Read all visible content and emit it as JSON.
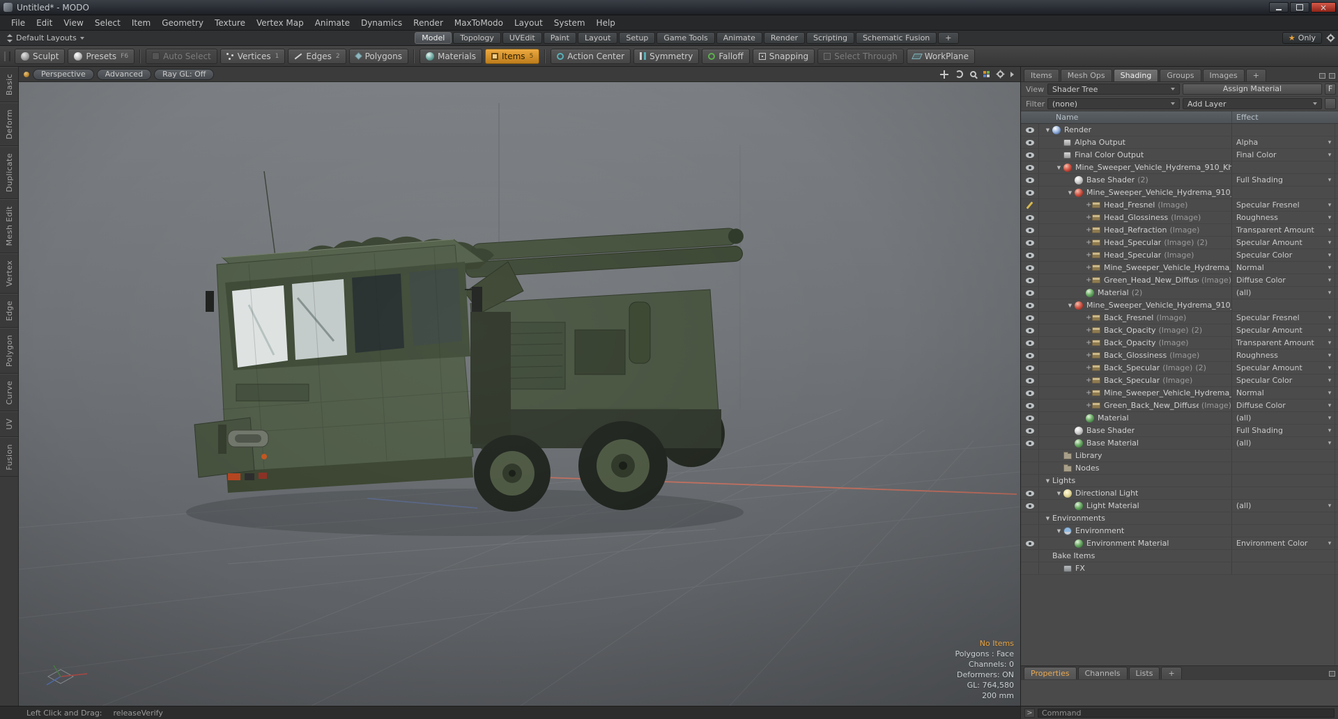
{
  "window": {
    "title": "Untitled* - MODO"
  },
  "menu": [
    "File",
    "Edit",
    "View",
    "Select",
    "Item",
    "Geometry",
    "Texture",
    "Vertex Map",
    "Animate",
    "Dynamics",
    "Render",
    "MaxToModo",
    "Layout",
    "System",
    "Help"
  ],
  "layout_bar": {
    "default_layouts": "Default Layouts",
    "tabs": [
      {
        "label": "Model",
        "active": true
      },
      {
        "label": "Topology"
      },
      {
        "label": "UVEdit"
      },
      {
        "label": "Paint"
      },
      {
        "label": "Layout"
      },
      {
        "label": "Setup"
      },
      {
        "label": "Game Tools"
      },
      {
        "label": "Animate"
      },
      {
        "label": "Render"
      },
      {
        "label": "Scripting"
      },
      {
        "label": "Schematic Fusion"
      },
      {
        "label": "+"
      }
    ],
    "only_label": "Only"
  },
  "toolbar": {
    "buttons": [
      {
        "label": "Sculpt",
        "icon": "sculpt-icon"
      },
      {
        "label": "Presets",
        "hint": "F6",
        "icon": "presets-icon"
      },
      {
        "sep": true
      },
      {
        "label": "Auto Select",
        "icon": "auto-select-icon",
        "disabled": true
      },
      {
        "label": "Vertices",
        "hint": "1",
        "icon": "vertices-icon"
      },
      {
        "label": "Edges",
        "hint": "2",
        "icon": "edges-icon"
      },
      {
        "label": "Polygons",
        "icon": "polygons-icon"
      },
      {
        "sep": true
      },
      {
        "label": "Materials",
        "icon": "materials-icon"
      },
      {
        "label": "Items",
        "hint": "5",
        "icon": "items-icon",
        "active": true
      },
      {
        "sep": true
      },
      {
        "label": "Action Center",
        "icon": "action-center-icon"
      },
      {
        "label": "Symmetry",
        "icon": "symmetry-icon"
      },
      {
        "label": "Falloff",
        "icon": "falloff-icon"
      },
      {
        "label": "Snapping",
        "icon": "snapping-icon"
      },
      {
        "label": "Select Through",
        "icon": "select-through-icon",
        "disabled": true
      },
      {
        "label": "WorkPlane",
        "icon": "workplane-icon"
      }
    ]
  },
  "left_tabs": [
    "Basic",
    "Deform",
    "Duplicate",
    "Mesh Edit",
    "Vertex",
    "Edge",
    "Polygon",
    "Curve",
    "UV",
    "Fusion"
  ],
  "viewport": {
    "tabs": [
      "Perspective",
      "Advanced",
      "Ray GL: Off"
    ],
    "stats": {
      "highlight": "No Items",
      "lines": [
        "Polygons : Face",
        "Channels: 0",
        "Deformers: ON",
        "GL: 764,580",
        "200 mm"
      ]
    }
  },
  "right_panel": {
    "tabs": [
      {
        "label": "Items"
      },
      {
        "label": "Mesh Ops"
      },
      {
        "label": "Shading",
        "active": true
      },
      {
        "label": "Groups"
      },
      {
        "label": "Images"
      },
      {
        "label": "+"
      }
    ],
    "view_label": "View",
    "view_value": "Shader Tree",
    "assign_material": "Assign Material",
    "f_button": "F",
    "filter_label": "Filter",
    "filter_value": "(none)",
    "add_layer": "Add Layer",
    "columns": {
      "name": "Name",
      "effect": "Effect"
    },
    "bottom_tabs": [
      {
        "label": "Properties",
        "active": true
      },
      {
        "label": "Channels"
      },
      {
        "label": "Lists"
      },
      {
        "label": "+"
      }
    ],
    "command_prompt": ">",
    "command_placeholder": "Command"
  },
  "shader_tree": {
    "rows": [
      {
        "d": 0,
        "a": 1,
        "g": "eye",
        "i": "render-icon",
        "t": "Render"
      },
      {
        "d": 1,
        "g": "eye",
        "i": "output-icon",
        "t": "Alpha Output",
        "e": "Alpha"
      },
      {
        "d": 1,
        "g": "eye",
        "i": "output-icon",
        "t": "Final Color Output",
        "e": "Final Color"
      },
      {
        "d": 1,
        "a": 1,
        "g": "eye",
        "i": "material-group-icon",
        "t": "Mine_Sweeper_Vehicle_Hydrema_910_Kh..."
      },
      {
        "d": 2,
        "g": "eye",
        "i": "shader-icon",
        "t": "Base Shader",
        "c": "(2)",
        "e": "Full Shading"
      },
      {
        "d": 2,
        "a": 1,
        "g": "eye",
        "i": "material-group-icon",
        "t": "Mine_Sweeper_Vehicle_Hydrema_910_..."
      },
      {
        "d": 3,
        "p": 1,
        "g": "pen",
        "i": "image-icon",
        "t": "Head_Fresnel",
        "s": "(Image)",
        "e": "Specular Fresnel"
      },
      {
        "d": 3,
        "p": 1,
        "g": "eye",
        "i": "image-icon",
        "t": "Head_Glossiness",
        "s": "(Image)",
        "e": "Roughness"
      },
      {
        "d": 3,
        "p": 1,
        "g": "eye",
        "i": "image-icon",
        "t": "Head_Refraction",
        "s": "(Image)",
        "e": "Transparent Amount"
      },
      {
        "d": 3,
        "p": 1,
        "g": "eye",
        "i": "image-icon",
        "t": "Head_Specular",
        "s": "(Image)",
        "c": "(2)",
        "e": "Specular Amount"
      },
      {
        "d": 3,
        "p": 1,
        "g": "eye",
        "i": "image-icon",
        "t": "Head_Specular",
        "s": "(Image)",
        "e": "Specular Color"
      },
      {
        "d": 3,
        "p": 1,
        "g": "eye",
        "i": "image-icon",
        "t": "Mine_Sweeper_Vehicle_Hydrema_91...",
        "e": "Normal"
      },
      {
        "d": 3,
        "p": 1,
        "g": "eye",
        "i": "image-icon",
        "t": "Green_Head_New_Diffuse",
        "s": "(Image)",
        "e": "Diffuse Color"
      },
      {
        "d": 3,
        "g": "eye",
        "i": "material-icon",
        "t": "Material",
        "c": "(2)",
        "e": "(all)"
      },
      {
        "d": 2,
        "a": 1,
        "g": "eye",
        "i": "material-group-icon",
        "t": "Mine_Sweeper_Vehicle_Hydrema_910_..."
      },
      {
        "d": 3,
        "p": 1,
        "g": "eye",
        "i": "image-icon",
        "t": "Back_Fresnel",
        "s": "(Image)",
        "e": "Specular Fresnel"
      },
      {
        "d": 3,
        "p": 1,
        "g": "eye",
        "i": "image-icon",
        "t": "Back_Opacity",
        "s": "(Image)",
        "c": "(2)",
        "e": "Specular Amount"
      },
      {
        "d": 3,
        "p": 1,
        "g": "eye",
        "i": "image-icon",
        "t": "Back_Opacity",
        "s": "(Image)",
        "e": "Transparent Amount"
      },
      {
        "d": 3,
        "p": 1,
        "g": "eye",
        "i": "image-icon",
        "t": "Back_Glossiness",
        "s": "(Image)",
        "e": "Roughness"
      },
      {
        "d": 3,
        "p": 1,
        "g": "eye",
        "i": "image-icon",
        "t": "Back_Specular",
        "s": "(Image)",
        "c": "(2)",
        "e": "Specular Amount"
      },
      {
        "d": 3,
        "p": 1,
        "g": "eye",
        "i": "image-icon",
        "t": "Back_Specular",
        "s": "(Image)",
        "e": "Specular Color"
      },
      {
        "d": 3,
        "p": 1,
        "g": "eye",
        "i": "image-icon",
        "t": "Mine_Sweeper_Vehicle_Hydrema_91...",
        "e": "Normal"
      },
      {
        "d": 3,
        "p": 1,
        "g": "eye",
        "i": "image-icon",
        "t": "Green_Back_New_Diffuse",
        "s": "(Image)",
        "e": "Diffuse Color"
      },
      {
        "d": 3,
        "g": "eye",
        "i": "material-icon",
        "t": "Material",
        "e": "(all)"
      },
      {
        "d": 2,
        "g": "eye",
        "i": "shader-icon",
        "t": "Base Shader",
        "e": "Full Shading"
      },
      {
        "d": 2,
        "g": "eye",
        "i": "material-icon",
        "t": "Base Material",
        "e": "(all)"
      },
      {
        "d": 1,
        "i": "folder-icon",
        "t": "Library"
      },
      {
        "d": 1,
        "i": "folder-icon",
        "t": "Nodes"
      },
      {
        "d": 0,
        "a": 1,
        "t": "Lights"
      },
      {
        "d": 1,
        "a": 1,
        "g": "eye",
        "i": "light-icon",
        "t": "Directional Light"
      },
      {
        "d": 2,
        "g": "eye",
        "i": "material-icon",
        "t": "Light Material",
        "e": "(all)"
      },
      {
        "d": 0,
        "a": 1,
        "t": "Environments"
      },
      {
        "d": 1,
        "a": 1,
        "i": "environment-icon",
        "t": "Environment"
      },
      {
        "d": 2,
        "g": "eye",
        "i": "material-icon",
        "t": "Environment Material",
        "e": "Environment Color"
      },
      {
        "d": 0,
        "t": "Bake Items"
      },
      {
        "d": 1,
        "i": "fx-icon",
        "t": "FX"
      }
    ]
  },
  "status_bar": {
    "text": "Left Click and Drag:",
    "value": "releaseVerify"
  },
  "colors": {
    "accent_orange": "#e8a33d",
    "items_button": "#d9952e",
    "axis_x_red": "#cf6f5c",
    "axis_z_blue": "#6b83c4",
    "vehicle_green": "#4d5a45",
    "viewport_gray": "#6f7377"
  }
}
